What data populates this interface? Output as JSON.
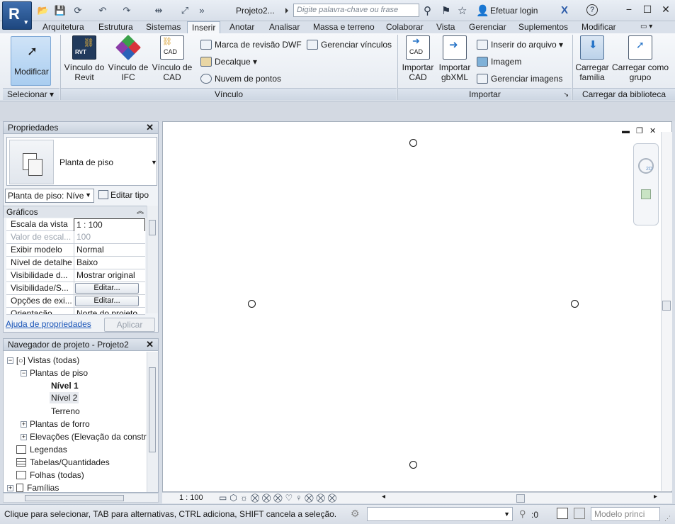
{
  "title_bar": {
    "doc_title": "Projeto2...",
    "search_placeholder": "Digite palavra-chave ou frase",
    "login_label": "Efetuar login",
    "help_label": "?"
  },
  "tabs": [
    "Arquitetura",
    "Estrutura",
    "Sistemas",
    "Inserir",
    "Anotar",
    "Analisar",
    "Massa e terreno",
    "Colaborar",
    "Vista",
    "Gerenciar",
    "Suplementos",
    "Modificar"
  ],
  "active_tab": "Inserir",
  "ribbon": {
    "modify_label": "Modificar",
    "select_label": "Selecionar",
    "link": {
      "label": "Vínculo",
      "revit": "Vínculo do Revit",
      "ifc": "Vínculo de IFC",
      "cad": "Vínculo de CAD",
      "dwf": "Marca de revisão  DWF",
      "decal": "Decalque",
      "cloud": "Nuvem  de pontos",
      "manage": "Gerenciar  vínculos"
    },
    "import": {
      "label": "Importar",
      "cad": "Importar CAD",
      "gbxml": "Importar gbXML",
      "file": "Inserir do  arquivo",
      "image": "Imagem",
      "manage": "Gerenciar  imagens"
    },
    "library": {
      "label": "Carregar da biblioteca",
      "family": "Carregar família",
      "group": "Carregar como grupo"
    }
  },
  "properties": {
    "title": "Propriedades",
    "type_name": "Planta de piso",
    "instance_select": "Planta de piso: Níve",
    "edit_type": "Editar tipo",
    "section": "Gráficos",
    "rows": [
      {
        "k": "Escala da vista",
        "v": "1 : 100"
      },
      {
        "k": "Valor de escal...",
        "v": "100"
      },
      {
        "k": "Exibir modelo",
        "v": "Normal"
      },
      {
        "k": "Nível de detalhe",
        "v": "Baixo"
      },
      {
        "k": "Visibilidade d...",
        "v": "Mostrar original"
      },
      {
        "k": "Visibilidade/S...",
        "v": "Editar..."
      },
      {
        "k": "Opções de exi...",
        "v": "Editar..."
      },
      {
        "k": "Orientação",
        "v": "Norte do projeto"
      }
    ],
    "help_link": "Ajuda de propriedades",
    "apply": "Aplicar"
  },
  "browser": {
    "title": "Navegador de projeto - Projeto2",
    "items": [
      "Vistas (todas)",
      "Plantas de piso",
      "Nível 1",
      "Nível 2",
      "Terreno",
      "Plantas de forro",
      "Elevações (Elevação da constr",
      "Legendas",
      "Tabelas/Quantidades",
      "Folhas (todas)",
      "Famílias"
    ]
  },
  "view_bar": {
    "scale": "1 : 100"
  },
  "status": {
    "message": "Clique para selecionar, TAB para alternativas, CTRL adiciona, SHIFT cancela a seleção.",
    "count": ":0",
    "model": "Modelo princi"
  }
}
